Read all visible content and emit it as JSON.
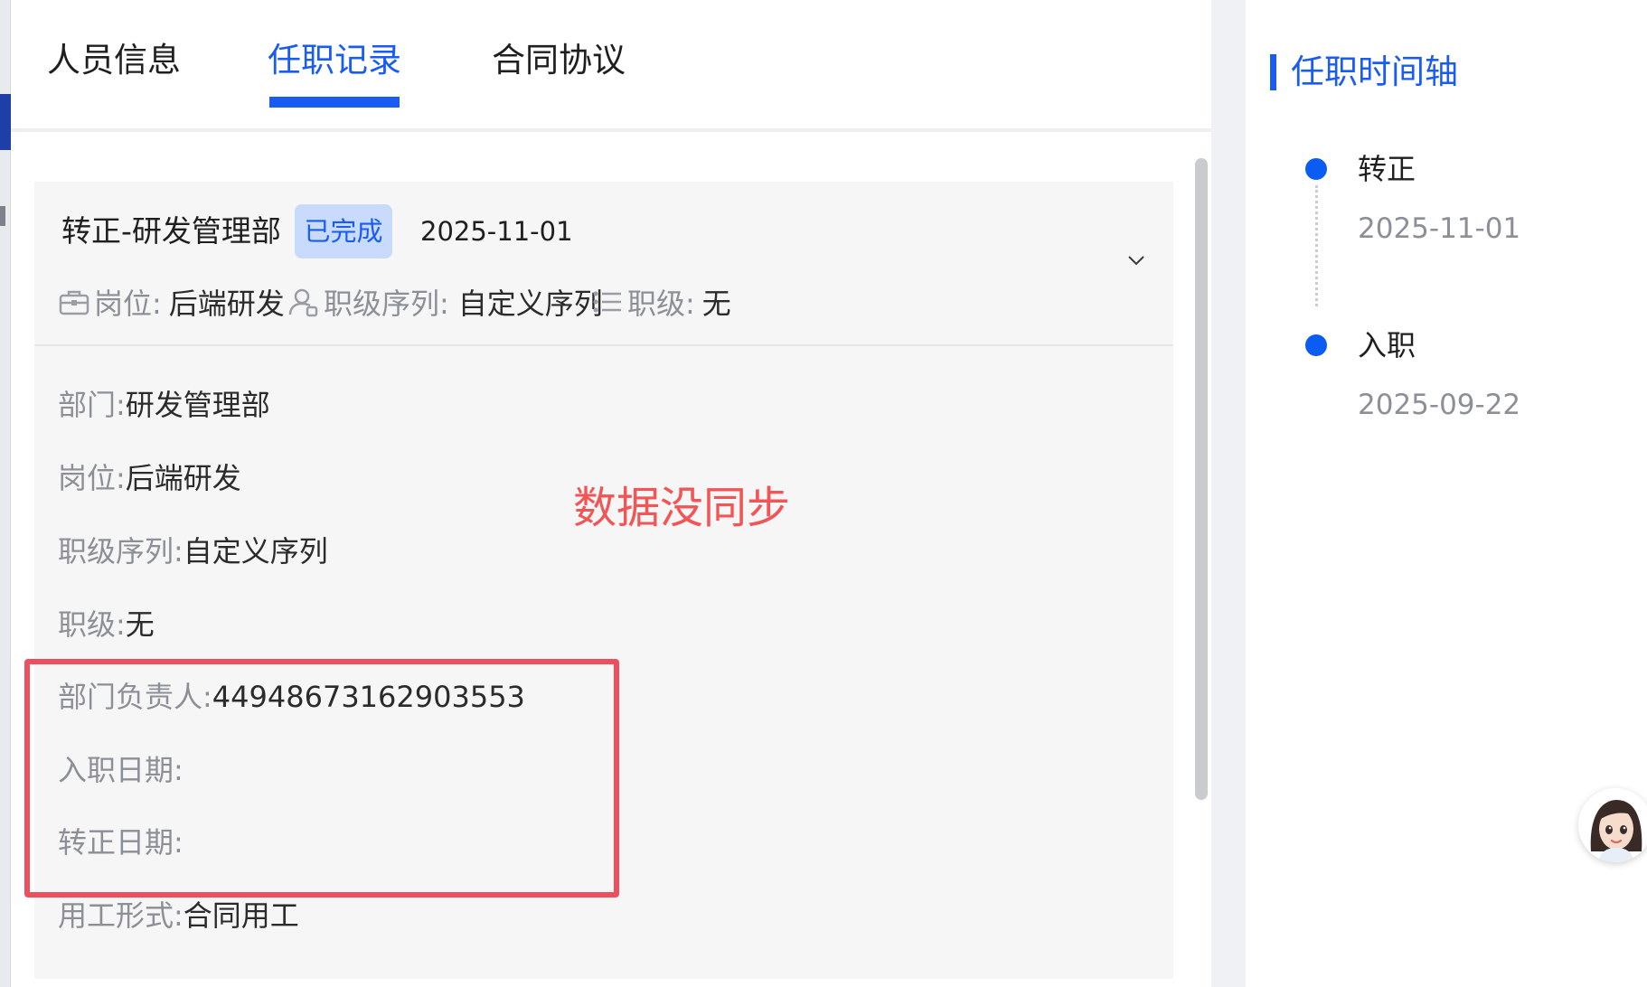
{
  "tabs": [
    {
      "label": "人员信息",
      "active": false
    },
    {
      "label": "任职记录",
      "active": true
    },
    {
      "label": "合同协议",
      "active": false
    }
  ],
  "record": {
    "title": "转正-研发管理部",
    "status": "已完成",
    "date": "2025-11-01",
    "meta": {
      "position_label": "岗位:",
      "position_value": "后端研发",
      "rank_series_label": "职级序列:",
      "rank_series_value": "自定义序列",
      "rank_label": "职级:",
      "rank_value": "无"
    },
    "fields": [
      {
        "label": "部门:",
        "value": "研发管理部"
      },
      {
        "label": "岗位:",
        "value": "后端研发"
      },
      {
        "label": "职级序列:",
        "value": "自定义序列"
      },
      {
        "label": "职级:",
        "value": "无"
      },
      {
        "label": "部门负责人:",
        "value": "449486731629035​53"
      },
      {
        "label": "入职日期:",
        "value": ""
      },
      {
        "label": "转正日期:",
        "value": ""
      },
      {
        "label": "用工形式:",
        "value": "合同用工"
      }
    ]
  },
  "annotation": {
    "text": "数据没同步",
    "color": "#f25555"
  },
  "timeline": {
    "title": "任职时间轴",
    "items": [
      {
        "label": "转正",
        "date": "2025-11-01"
      },
      {
        "label": "入职",
        "date": "2025-09-22"
      }
    ]
  },
  "colors": {
    "accent": "#1a5cf2",
    "badge_bg": "#c8dbfc",
    "annotation_box": "#ee4f5f"
  },
  "icons": {
    "position": "briefcase-icon",
    "rank_series": "user-badge-icon",
    "rank": "list-icon",
    "expand": "chevron-down-icon",
    "assistant": "assistant-avatar-icon"
  }
}
